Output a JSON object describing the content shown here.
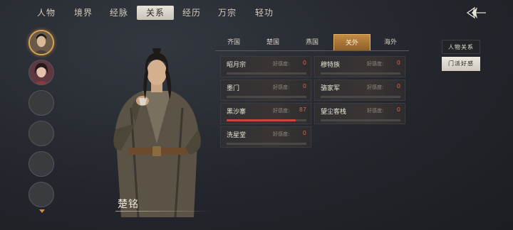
{
  "nav": {
    "tabs": [
      {
        "label": "人物"
      },
      {
        "label": "境界"
      },
      {
        "label": "经脉"
      },
      {
        "label": "关系"
      },
      {
        "label": "经历"
      },
      {
        "label": "万宗"
      },
      {
        "label": "轻功"
      }
    ],
    "active_tab": "关系"
  },
  "character": {
    "name": "楚铭"
  },
  "relations": {
    "region_tabs": [
      {
        "label": "齐国"
      },
      {
        "label": "楚国"
      },
      {
        "label": "燕国"
      },
      {
        "label": "关外"
      },
      {
        "label": "海外"
      }
    ],
    "active_region": "关外",
    "favor_label": "好感度:",
    "factions": [
      {
        "name": "昭月宗",
        "favor": 0,
        "favor_text": "0"
      },
      {
        "name": "穆特族",
        "favor": 0,
        "favor_text": "0"
      },
      {
        "name": "墨门",
        "favor": 0,
        "favor_text": "0"
      },
      {
        "name": "骆家军",
        "favor": 0,
        "favor_text": "0"
      },
      {
        "name": "黑沙寨",
        "favor": 87,
        "favor_text": "87"
      },
      {
        "name": "望尘客栈",
        "favor": 0,
        "favor_text": "0"
      },
      {
        "name": "洗星堂",
        "favor": 0,
        "favor_text": "0"
      }
    ]
  },
  "side_buttons": {
    "character_relations": "人物关系",
    "sect_favor": "门派好感"
  },
  "colors": {
    "accent_gold": "#d9a451",
    "favor_value": "#d2664e",
    "favor_bar": "#c24a3c"
  }
}
